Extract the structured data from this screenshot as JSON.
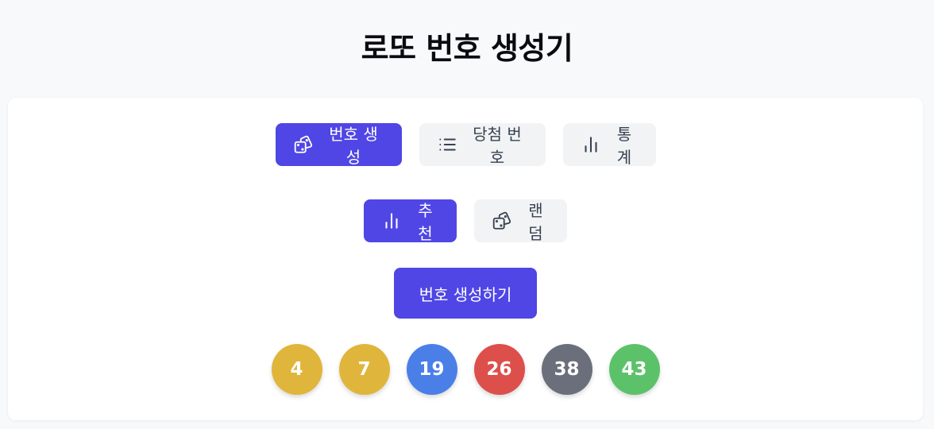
{
  "title": "로또 번호 생성기",
  "tabs": [
    {
      "label": "번호 생성",
      "icon": "dice-icon",
      "active": true
    },
    {
      "label": "당첨 번호",
      "icon": "list-icon",
      "active": false
    },
    {
      "label": "통계",
      "icon": "bar-chart-icon",
      "active": false
    }
  ],
  "modes": [
    {
      "label": "추천",
      "icon": "bar-chart-icon",
      "active": true
    },
    {
      "label": "랜덤",
      "icon": "dice-icon",
      "active": false
    }
  ],
  "generate_label": "번호 생성하기",
  "numbers": [
    {
      "value": "4",
      "color": "#e0b53b"
    },
    {
      "value": "7",
      "color": "#e0b53b"
    },
    {
      "value": "19",
      "color": "#4a7fe8"
    },
    {
      "value": "26",
      "color": "#dd4f4b"
    },
    {
      "value": "38",
      "color": "#6b6f7b"
    },
    {
      "value": "43",
      "color": "#5cc26a"
    }
  ],
  "colors": {
    "accent": "#4f46e5",
    "secondary_bg": "#f2f3f5"
  }
}
